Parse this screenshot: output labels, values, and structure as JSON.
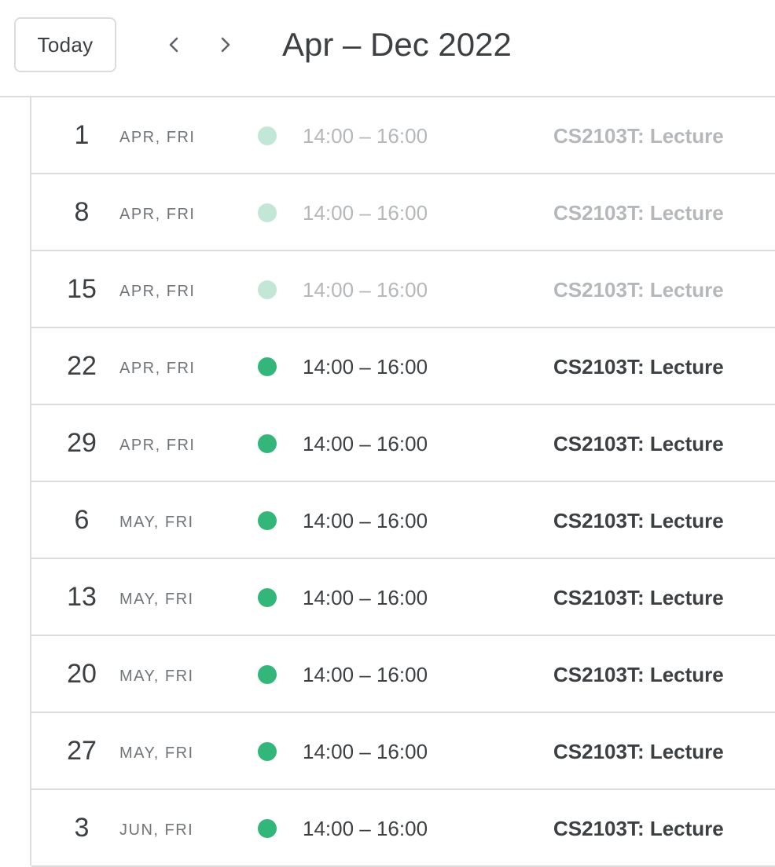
{
  "toolbar": {
    "today_label": "Today",
    "prev_icon": "chevron-left-icon",
    "next_icon": "chevron-right-icon",
    "range_title": "Apr – Dec 2022"
  },
  "colors": {
    "event_active": "#33b679",
    "event_past": "#c2e7d6",
    "divider": "#dadce0"
  },
  "events": [
    {
      "day": "1",
      "meta": "APR, FRI",
      "time": "14:00 – 16:00",
      "title": "CS2103T: Lecture",
      "past": true
    },
    {
      "day": "8",
      "meta": "APR, FRI",
      "time": "14:00 – 16:00",
      "title": "CS2103T: Lecture",
      "past": true
    },
    {
      "day": "15",
      "meta": "APR, FRI",
      "time": "14:00 – 16:00",
      "title": "CS2103T: Lecture",
      "past": true
    },
    {
      "day": "22",
      "meta": "APR, FRI",
      "time": "14:00 – 16:00",
      "title": "CS2103T: Lecture",
      "past": false
    },
    {
      "day": "29",
      "meta": "APR, FRI",
      "time": "14:00 – 16:00",
      "title": "CS2103T: Lecture",
      "past": false
    },
    {
      "day": "6",
      "meta": "MAY, FRI",
      "time": "14:00 – 16:00",
      "title": "CS2103T: Lecture",
      "past": false
    },
    {
      "day": "13",
      "meta": "MAY, FRI",
      "time": "14:00 – 16:00",
      "title": "CS2103T: Lecture",
      "past": false
    },
    {
      "day": "20",
      "meta": "MAY, FRI",
      "time": "14:00 – 16:00",
      "title": "CS2103T: Lecture",
      "past": false
    },
    {
      "day": "27",
      "meta": "MAY, FRI",
      "time": "14:00 – 16:00",
      "title": "CS2103T: Lecture",
      "past": false
    },
    {
      "day": "3",
      "meta": "JUN, FRI",
      "time": "14:00 – 16:00",
      "title": "CS2103T: Lecture",
      "past": false
    }
  ]
}
